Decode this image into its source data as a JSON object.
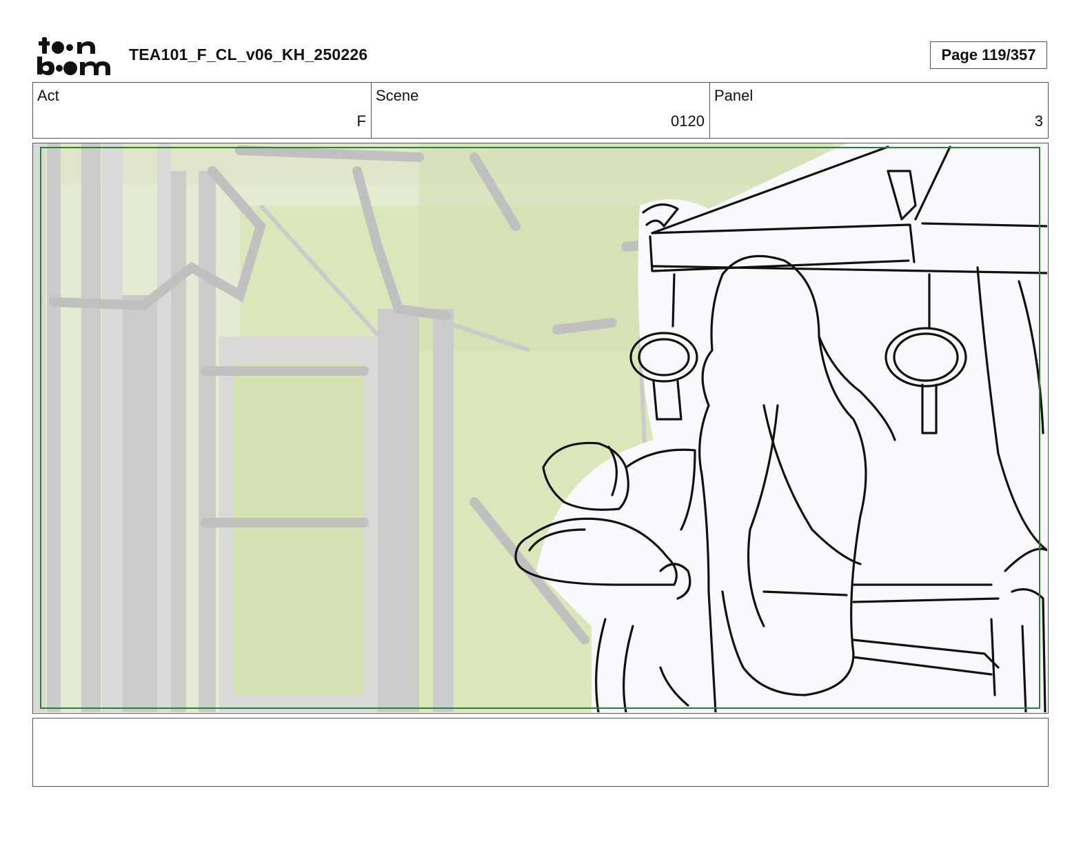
{
  "header": {
    "logo_text": "toonboom",
    "document_title": "TEA101_F_CL_v06_KH_250226",
    "page_label": "Page 119/357"
  },
  "info": {
    "act": {
      "label": "Act",
      "value": "F"
    },
    "scene": {
      "label": "Scene",
      "value": "0120"
    },
    "panel": {
      "label": "Panel",
      "value": "3"
    }
  },
  "panel_image": {
    "safe_area_color": "#2e7d32",
    "background_tint": "#e3ead0"
  },
  "notes": {
    "text": ""
  }
}
